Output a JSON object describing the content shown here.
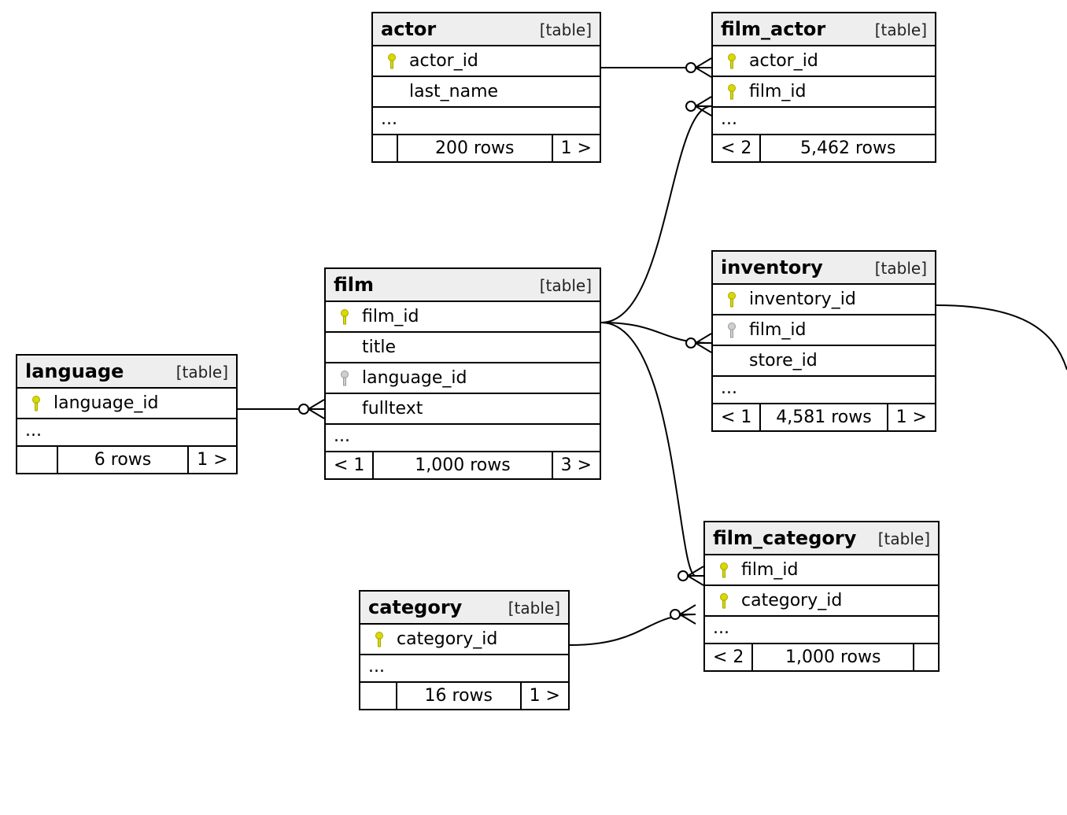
{
  "type_label": "[table]",
  "ellipsis": "...",
  "tables": {
    "actor": {
      "name": "actor",
      "cols": [
        {
          "key": "pk",
          "name": "actor_id"
        },
        {
          "key": "",
          "name": "last_name"
        }
      ],
      "footer": {
        "in": "",
        "rows": "200 rows",
        "out": "1 >"
      }
    },
    "film_actor": {
      "name": "film_actor",
      "cols": [
        {
          "key": "pk",
          "name": "actor_id"
        },
        {
          "key": "pk",
          "name": "film_id"
        }
      ],
      "footer": {
        "in": "< 2",
        "rows": "5,462 rows",
        "out": ""
      }
    },
    "language": {
      "name": "language",
      "cols": [
        {
          "key": "pk",
          "name": "language_id"
        }
      ],
      "footer": {
        "in": "",
        "rows": "6 rows",
        "out": "1 >"
      }
    },
    "film": {
      "name": "film",
      "cols": [
        {
          "key": "pk",
          "name": "film_id"
        },
        {
          "key": "",
          "name": "title"
        },
        {
          "key": "fk",
          "name": "language_id"
        },
        {
          "key": "",
          "name": "fulltext"
        }
      ],
      "footer": {
        "in": "< 1",
        "rows": "1,000 rows",
        "out": "3 >"
      }
    },
    "inventory": {
      "name": "inventory",
      "cols": [
        {
          "key": "pk",
          "name": "inventory_id"
        },
        {
          "key": "fk",
          "name": "film_id"
        },
        {
          "key": "",
          "name": "store_id"
        }
      ],
      "footer": {
        "in": "< 1",
        "rows": "4,581 rows",
        "out": "1 >"
      }
    },
    "category": {
      "name": "category",
      "cols": [
        {
          "key": "pk",
          "name": "category_id"
        }
      ],
      "footer": {
        "in": "",
        "rows": "16 rows",
        "out": "1 >"
      }
    },
    "film_category": {
      "name": "film_category",
      "cols": [
        {
          "key": "pk",
          "name": "film_id"
        },
        {
          "key": "pk",
          "name": "category_id"
        }
      ],
      "footer": {
        "in": "< 2",
        "rows": "1,000 rows",
        "out": ""
      }
    }
  },
  "relationships": [
    {
      "from": "actor.actor_id",
      "to": "film_actor.actor_id",
      "type": "one-to-many"
    },
    {
      "from": "film.film_id",
      "to": "film_actor.film_id",
      "type": "one-to-many"
    },
    {
      "from": "language.language_id",
      "to": "film.language_id",
      "type": "one-to-many"
    },
    {
      "from": "film.film_id",
      "to": "inventory.film_id",
      "type": "one-to-many"
    },
    {
      "from": "film.film_id",
      "to": "film_category.film_id",
      "type": "one-to-many"
    },
    {
      "from": "category.category_id",
      "to": "film_category.category_id",
      "type": "one-to-many"
    }
  ]
}
